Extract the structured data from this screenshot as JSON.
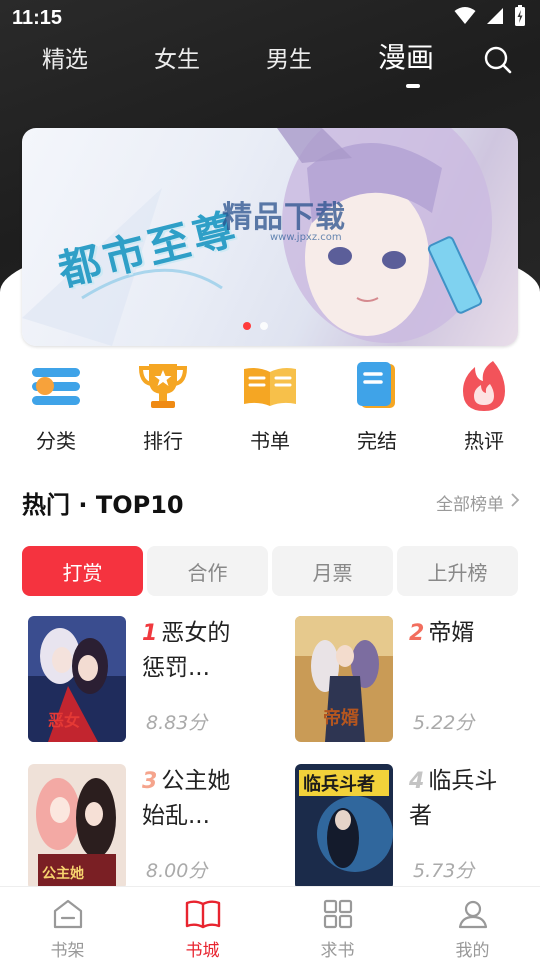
{
  "status": {
    "time": "11:15"
  },
  "top_tabs": [
    {
      "label": "精选"
    },
    {
      "label": "女生"
    },
    {
      "label": "男生"
    },
    {
      "label": "漫画",
      "active": true
    }
  ],
  "banner": {
    "title": "都市至尊",
    "watermark": "精品下载",
    "watermark_sub": "www.jpxz.com",
    "dot_count": 2,
    "active_dot": 1
  },
  "categories": [
    {
      "label": "分类",
      "icon": "category-list-icon"
    },
    {
      "label": "排行",
      "icon": "trophy-icon"
    },
    {
      "label": "书单",
      "icon": "open-book-icon"
    },
    {
      "label": "完结",
      "icon": "closed-book-icon"
    },
    {
      "label": "热评",
      "icon": "flame-icon"
    }
  ],
  "section": {
    "title": "热门 · TOP10",
    "more": "全部榜单"
  },
  "rank_tabs": [
    {
      "label": "打赏",
      "active": true
    },
    {
      "label": "合作"
    },
    {
      "label": "月票"
    },
    {
      "label": "上升榜"
    }
  ],
  "books": [
    {
      "rank": "1",
      "title_line1": "恶女的",
      "title_line2": "惩罚...",
      "score": "8.83分",
      "rank_color": "#f0393e"
    },
    {
      "rank": "2",
      "title_line1": "帝婿",
      "title_line2": "",
      "score": "5.22分",
      "rank_color": "#f26e5e"
    },
    {
      "rank": "3",
      "title_line1": "公主她",
      "title_line2": "始乱...",
      "score": "8.00分",
      "rank_color": "#f5a48c"
    },
    {
      "rank": "4",
      "title_line1": "临兵斗",
      "title_line2": "者",
      "score": "5.73分",
      "rank_color": "#c4c4c4"
    }
  ],
  "bottom_nav": [
    {
      "label": "书架",
      "icon": "bookshelf-icon"
    },
    {
      "label": "书城",
      "icon": "book-store-icon",
      "active": true
    },
    {
      "label": "求书",
      "icon": "grid-request-icon"
    },
    {
      "label": "我的",
      "icon": "profile-icon"
    }
  ],
  "colors": {
    "accent": "#e8242f",
    "blue": "#3fa3e8",
    "gold": "#f5a623"
  }
}
